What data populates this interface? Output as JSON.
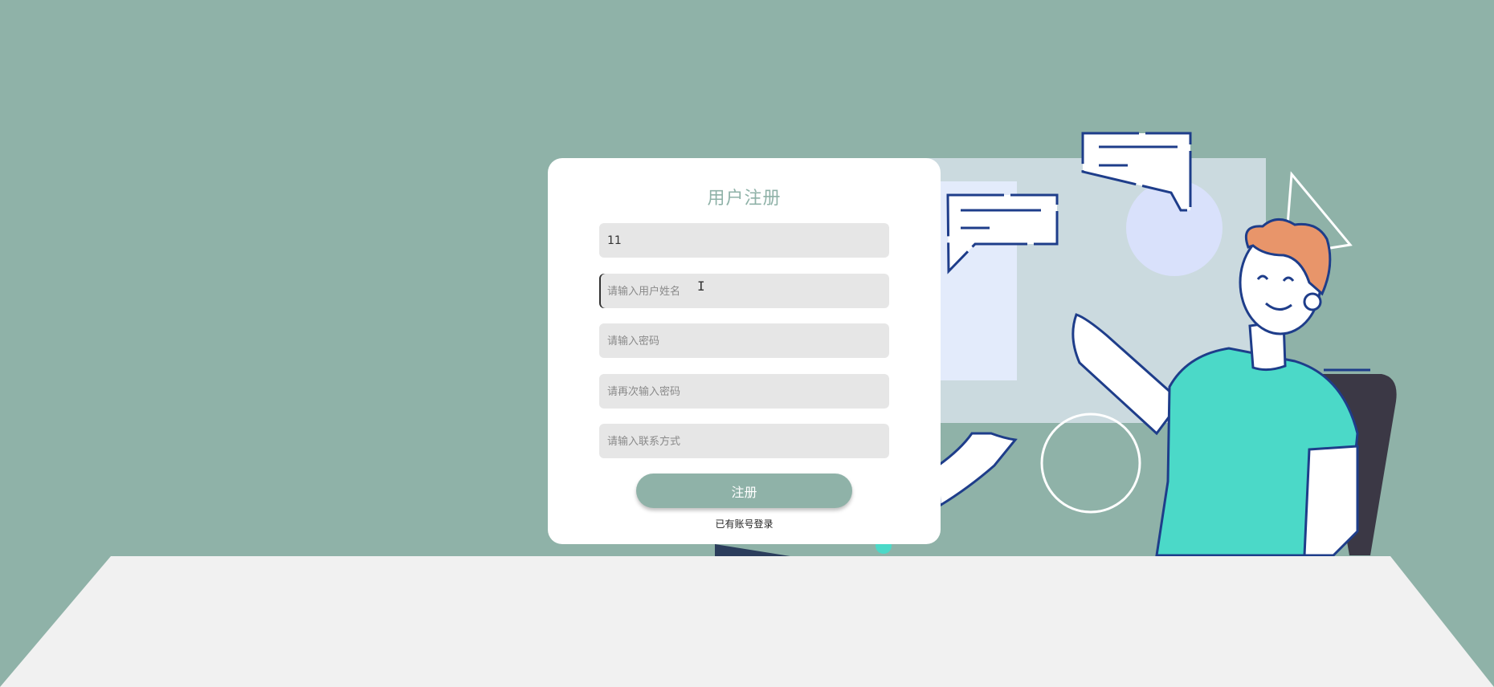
{
  "form": {
    "title": "用户注册",
    "username": {
      "value": "11",
      "placeholder": ""
    },
    "realname": {
      "value": "",
      "placeholder": "请输入用户姓名"
    },
    "password": {
      "value": "",
      "placeholder": "请输入密码"
    },
    "confirm_password": {
      "value": "",
      "placeholder": "请再次输入密码"
    },
    "contact": {
      "value": "",
      "placeholder": "请输入联系方式"
    },
    "submit_label": "注册",
    "login_link": "已有账号登录"
  },
  "colors": {
    "background": "#8fb2a8",
    "floor": "#f1f1f1",
    "card": "#ffffff",
    "accent": "#8fb2a8",
    "outline": "#1e3d8a",
    "shirt": "#4bd9c8",
    "hair": "#e8956a",
    "chair": "#3b3845"
  }
}
